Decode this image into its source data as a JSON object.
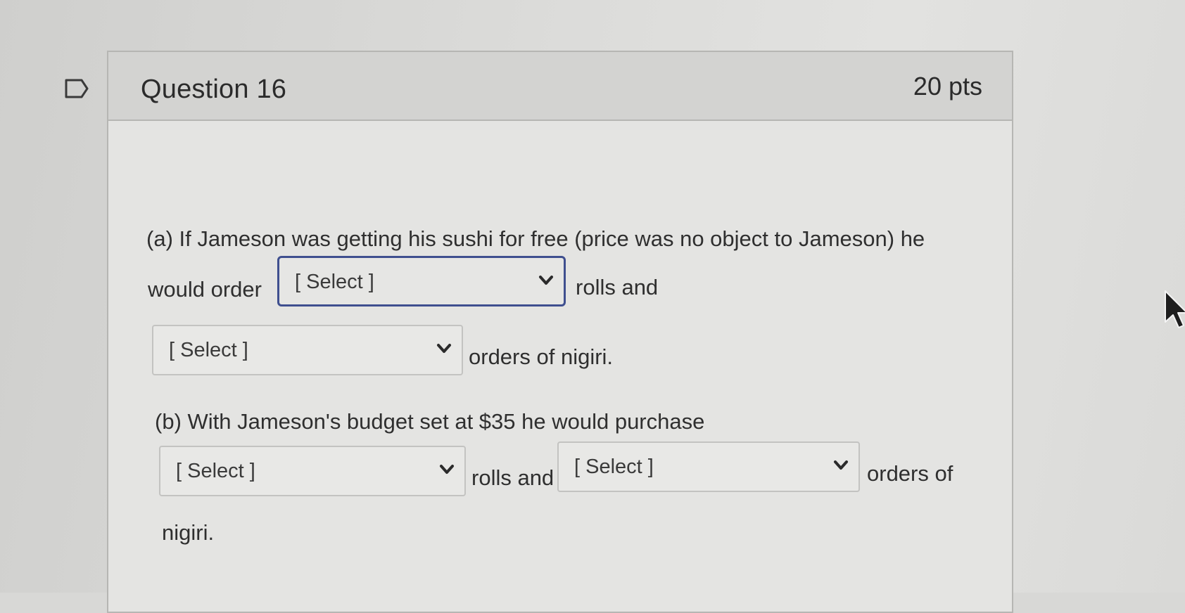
{
  "question": {
    "title": "Question 16",
    "points": "20 pts"
  },
  "part_a": {
    "line1": "(a) If Jameson was getting his sushi for free (price was no object to Jameson) he",
    "would_order": "would order",
    "rolls_and": "rolls and",
    "orders_of_nigiri": "orders of nigiri."
  },
  "part_b": {
    "line1": "(b) With Jameson's budget set at $35 he would purchase",
    "rolls_and": "rolls and",
    "orders_of": "orders of",
    "nigiri": "nigiri."
  },
  "selects": [
    {
      "selected": "[ Select ]"
    },
    {
      "selected": "[ Select ]"
    },
    {
      "selected": "[ Select ]"
    },
    {
      "selected": "[ Select ]"
    }
  ],
  "icons": {
    "flag": "flag-outline-icon",
    "chevron": "chevron-down-icon",
    "cursor": "mouse-pointer-icon"
  },
  "colors": {
    "focus_border": "#3f4f8f"
  }
}
